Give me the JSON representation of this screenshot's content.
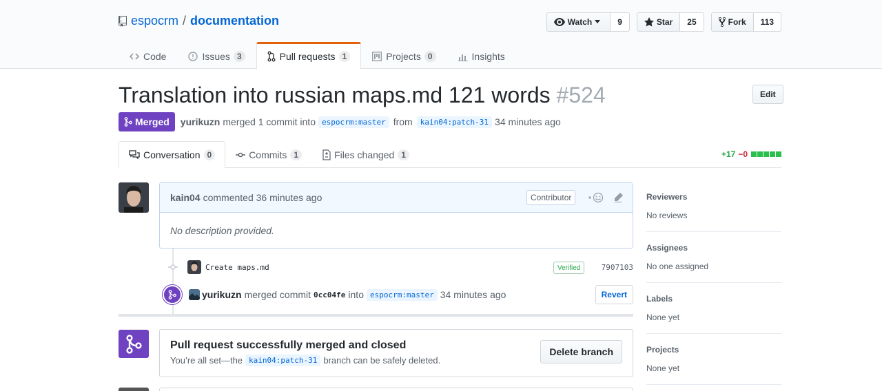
{
  "repo": {
    "owner": "espocrm",
    "separator": "/",
    "name": "documentation"
  },
  "actions": {
    "watch_label": "Watch",
    "watch_count": "9",
    "star_label": "Star",
    "star_count": "25",
    "fork_label": "Fork",
    "fork_count": "113"
  },
  "reponav": [
    {
      "label": "Code",
      "count": ""
    },
    {
      "label": "Issues",
      "count": "3"
    },
    {
      "label": "Pull requests",
      "count": "1"
    },
    {
      "label": "Projects",
      "count": "0"
    },
    {
      "label": "Insights",
      "count": ""
    }
  ],
  "pr": {
    "title": "Translation into russian maps.md 121 words",
    "number": "#524",
    "edit_label": "Edit",
    "state": "Merged",
    "merger": "yurikuzn",
    "meta_text": "merged 1 commit into",
    "base": "espocrm:master",
    "from_text": "from",
    "head": "kain04:patch-31",
    "time": "34 minutes ago"
  },
  "tabs": [
    {
      "label": "Conversation",
      "count": "0"
    },
    {
      "label": "Commits",
      "count": "1"
    },
    {
      "label": "Files changed",
      "count": "1"
    }
  ],
  "diffstat": {
    "added": "+17",
    "removed": "−0"
  },
  "comment": {
    "author": "kain04",
    "action": "commented 36 minutes ago",
    "label": "Contributor",
    "body": "No description provided."
  },
  "commit": {
    "message": "Create maps.md",
    "verified": "Verified",
    "sha": "7907103"
  },
  "merged_event": {
    "actor": "yurikuzn",
    "text": "merged commit",
    "sha": "0cc04fe",
    "into": "into",
    "branch": "espocrm:master",
    "time": "34 minutes ago",
    "revert_label": "Revert"
  },
  "merge_box": {
    "title": "Pull request successfully merged and closed",
    "sub_before": "You’re all set—the",
    "branch": "kain04:patch-31",
    "sub_after": "branch can be safely deleted.",
    "delete_label": "Delete branch"
  },
  "sidebar": [
    {
      "heading": "Reviewers",
      "value": "No reviews"
    },
    {
      "heading": "Assignees",
      "value": "No one assigned"
    },
    {
      "heading": "Labels",
      "value": "None yet"
    },
    {
      "heading": "Projects",
      "value": "None yet"
    }
  ],
  "colors": {
    "merged": "#6f42c1",
    "link": "#0366d6",
    "nav_accent": "#e36209",
    "add": "#28a745",
    "remove": "#cb2431"
  }
}
